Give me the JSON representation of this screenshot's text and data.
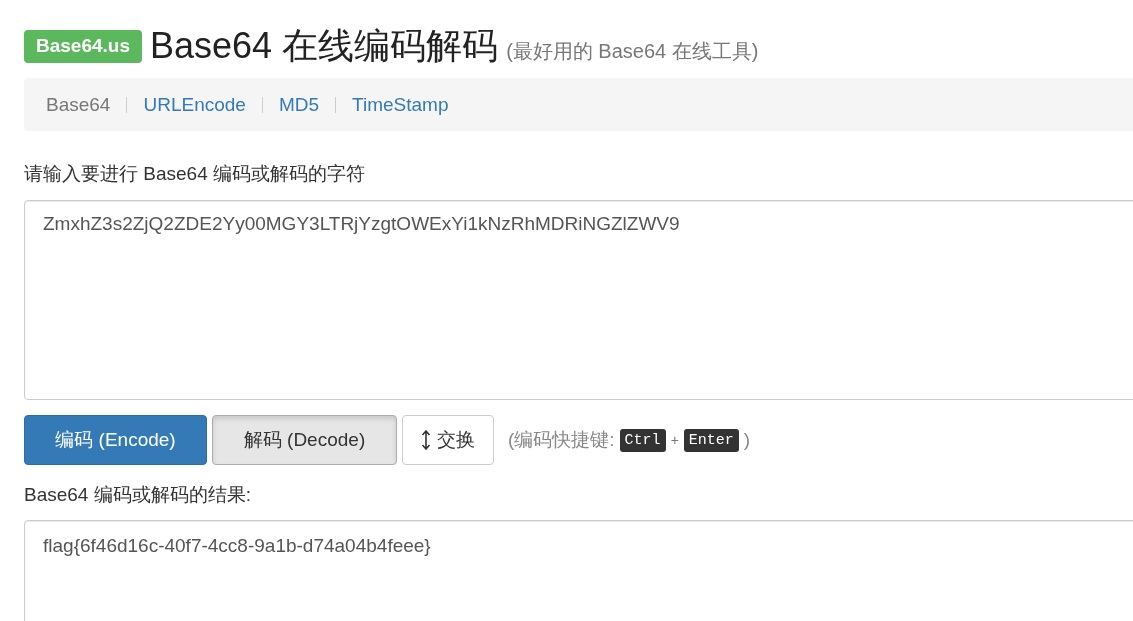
{
  "header": {
    "badge": "Base64.us",
    "title": "Base64 在线编码解码",
    "subtitle": "(最好用的 Base64 在线工具)"
  },
  "nav": [
    {
      "label": "Base64",
      "selected": true
    },
    {
      "label": "URLEncode",
      "selected": false
    },
    {
      "label": "MD5",
      "selected": false
    },
    {
      "label": "TimeStamp",
      "selected": false
    }
  ],
  "input": {
    "label": "请输入要进行 Base64 编码或解码的字符",
    "value": "ZmxhZ3s2ZjQ2ZDE2Yy00MGY3LTRjYzgtOWExYi1kNzRhMDRiNGZlZWV9"
  },
  "buttons": [
    {
      "kind": "primary",
      "label": "编码 (Encode)",
      "pressed": false
    },
    {
      "kind": "default",
      "label": "解码 (Decode)",
      "pressed": true
    },
    {
      "kind": "swap",
      "label": "交换",
      "pressed": false
    }
  ],
  "shortcut": {
    "text": "(编码快捷键:",
    "keys": [
      "Ctrl",
      "Enter"
    ],
    "plus": "+",
    "close": ")"
  },
  "output": {
    "label": "Base64 编码或解码的结果:",
    "value": "flag{6f46d16c-40f7-4cc8-9a1b-d74a04b4feee}"
  }
}
